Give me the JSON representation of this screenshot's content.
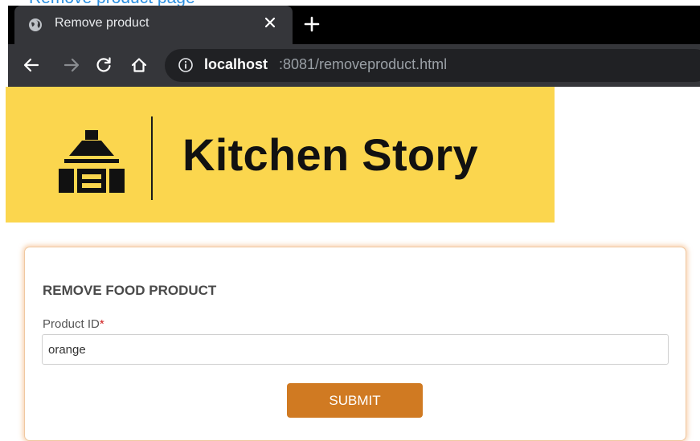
{
  "page": {
    "caption": "Remove product page"
  },
  "browser": {
    "tab": {
      "title": "Remove product",
      "close_icon": "close-icon",
      "favicon": "globe-icon"
    },
    "new_tab_icon": "plus-icon",
    "nav_icons": [
      "back-arrow-icon",
      "forward-arrow-icon",
      "reload-icon",
      "home-icon"
    ],
    "address": {
      "host": "localhost",
      "rest": ":8081/removeproduct.html",
      "info_icon": "info-icon"
    }
  },
  "banner": {
    "brand": "Kitchen Story",
    "logo_icon": "kitchen-hood-icon",
    "background": "#fbd64e"
  },
  "form": {
    "heading": "REMOVE FOOD PRODUCT",
    "field_label": "Product ID",
    "required_mark": "*",
    "input_value": "orange",
    "submit_label": "SUBMIT",
    "accent": "#d07a22"
  }
}
